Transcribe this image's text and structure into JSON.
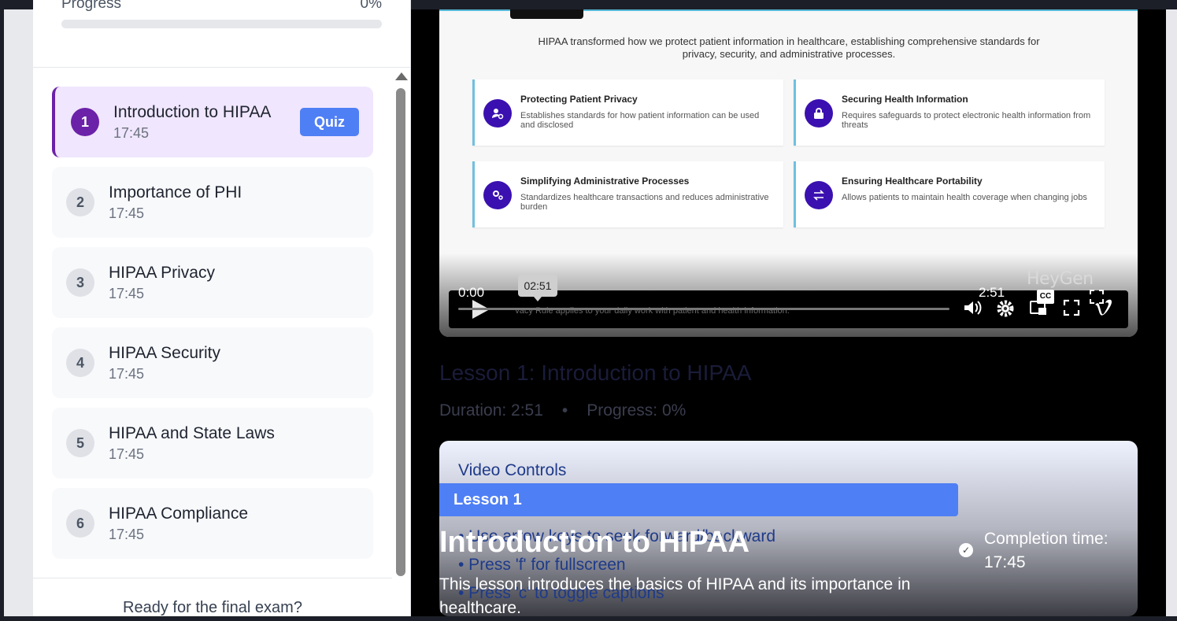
{
  "sidebar": {
    "progress_label": "Progress",
    "progress_value": "0%",
    "progress_fraction": 0,
    "lessons": [
      {
        "number": "1",
        "title": "Introduction to HIPAA",
        "duration": "17:45",
        "quiz_label": "Quiz"
      },
      {
        "number": "2",
        "title": "Importance of PHI",
        "duration": "17:45"
      },
      {
        "number": "3",
        "title": "HIPAA Privacy",
        "duration": "17:45"
      },
      {
        "number": "4",
        "title": "HIPAA Security",
        "duration": "17:45"
      },
      {
        "number": "5",
        "title": "HIPAA and State Laws",
        "duration": "17:45"
      },
      {
        "number": "6",
        "title": "HIPAA Compliance",
        "duration": "17:45"
      }
    ],
    "final_exam_text": "Ready for the final exam?"
  },
  "video": {
    "slide_intro": "HIPAA transformed how we protect patient information in healthcare, establishing comprehensive standards for privacy, security, and administrative processes.",
    "cards": [
      {
        "title": "Protecting Patient Privacy",
        "desc": "Establishes standards for how patient information can be used and disclosed",
        "icon": "user-shield-icon"
      },
      {
        "title": "Securing Health Information",
        "desc": "Requires safeguards to protect electronic health information from threats",
        "icon": "lock-icon"
      },
      {
        "title": "Simplifying Administrative Processes",
        "desc": "Standardizes healthcare transactions and reduces administrative burden",
        "icon": "gears-icon"
      },
      {
        "title": "Ensuring Healthcare Portability",
        "desc": "Allows patients to maintain health coverage when changing jobs",
        "icon": "exchange-icon"
      }
    ],
    "brand": "HeyGen",
    "current_time": "0:00",
    "total_time": "2:51",
    "hover_time": "02:51",
    "caption_text": "HIPAA's Privacy Rule applies to your daily work with patient and health information.",
    "cc_label": "CC"
  },
  "lesson_info": {
    "heading": "Lesson 1: Introduction to HIPAA",
    "duration": "Duration: 2:51",
    "separator": "•",
    "progress": "Progress: 0%"
  },
  "video_controls": {
    "title": "Video Controls",
    "tips": [
      "• Use arrow keys to seek forward/backward",
      "• Press 'f' for fullscreen",
      "• Press 'c' to toggle captions"
    ]
  },
  "overlay": {
    "tag": "Lesson 1",
    "title": "Introduction to HIPAA",
    "description": "This lesson introduces the basics of HIPAA and its importance in healthcare.",
    "completion_label": "Completion time:",
    "completion_value": "17:45"
  },
  "colors": {
    "accent_purple": "#6b21a8",
    "accent_blue": "#4f7ff5",
    "card_icon": "#3b10b0"
  }
}
